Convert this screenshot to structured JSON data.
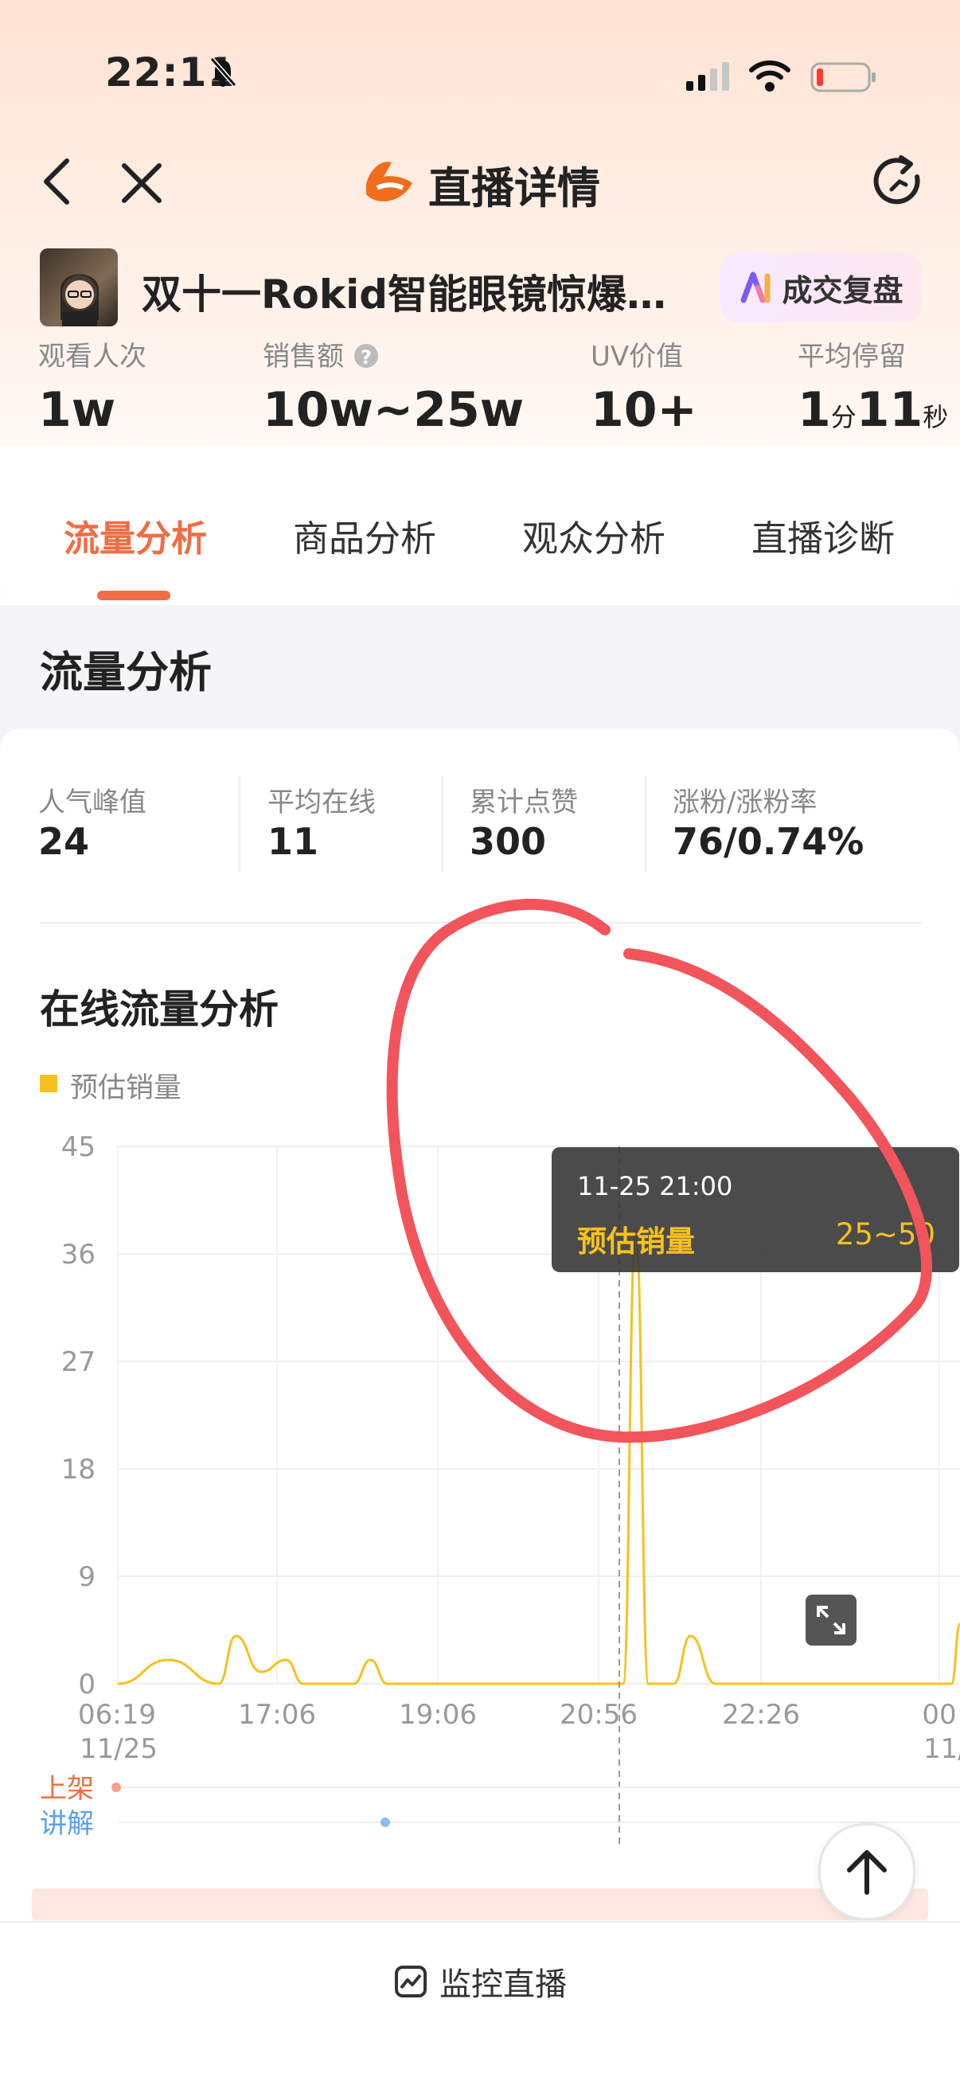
{
  "status_bar": {
    "time": "22:11"
  },
  "nav": {
    "title": "直播详情"
  },
  "live": {
    "title": "双十一Rokid智能眼镜惊爆…",
    "deal_button": "成交复盘"
  },
  "metrics": [
    {
      "label": "观看人次",
      "value": "1w"
    },
    {
      "label": "销售额",
      "value": "10w~25w"
    },
    {
      "label": "UV价值",
      "value": "10+"
    },
    {
      "label": "平均停留",
      "value_min": "1",
      "unit_min": "分",
      "value_sec": "11",
      "unit_sec": "秒"
    }
  ],
  "tabs": [
    "流量分析",
    "商品分析",
    "观众分析",
    "直播诊断"
  ],
  "section_title": "流量分析",
  "stats": [
    {
      "label": "人气峰值",
      "value": "24"
    },
    {
      "label": "平均在线",
      "value": "11"
    },
    {
      "label": "累计点赞",
      "value": "300"
    },
    {
      "label": "涨粉/涨粉率",
      "value": "76/0.74%"
    }
  ],
  "chart_title": "在线流量分析",
  "legend": "预估销量",
  "tooltip": {
    "date": "11-25 21:00",
    "series": "预估销量",
    "value": "25~50"
  },
  "event_rows": {
    "row1": "上架",
    "row2": "讲解"
  },
  "bottom": {
    "monitor_label": "监控直播"
  },
  "colors": {
    "accent": "#f06d44",
    "series": "#f7c11d",
    "annotation": "#f2545b",
    "explain": "#5aa0f0"
  },
  "chart_data": {
    "type": "line",
    "series": [
      {
        "name": "预估销量"
      }
    ],
    "ylim": [
      0,
      45
    ],
    "y_ticks": [
      "45",
      "36",
      "27",
      "18",
      "9",
      "0"
    ],
    "x_ticks": [
      "06:19",
      "17:06",
      "19:06",
      "20:56",
      "22:26",
      "00"
    ],
    "x_subticks": [
      "11/25",
      "11/"
    ],
    "points": [
      [
        0.0,
        0
      ],
      [
        0.06,
        2
      ],
      [
        0.12,
        0
      ],
      [
        0.14,
        4
      ],
      [
        0.17,
        1
      ],
      [
        0.2,
        2
      ],
      [
        0.22,
        0
      ],
      [
        0.28,
        0
      ],
      [
        0.3,
        2
      ],
      [
        0.32,
        0
      ],
      [
        0.6,
        0
      ],
      [
        0.615,
        38
      ],
      [
        0.63,
        0
      ],
      [
        0.66,
        0
      ],
      [
        0.68,
        4
      ],
      [
        0.71,
        0
      ],
      [
        0.99,
        0
      ],
      [
        1.0,
        5
      ]
    ],
    "highlight_time": "11-25 21:00",
    "highlight_value": "25~50"
  }
}
